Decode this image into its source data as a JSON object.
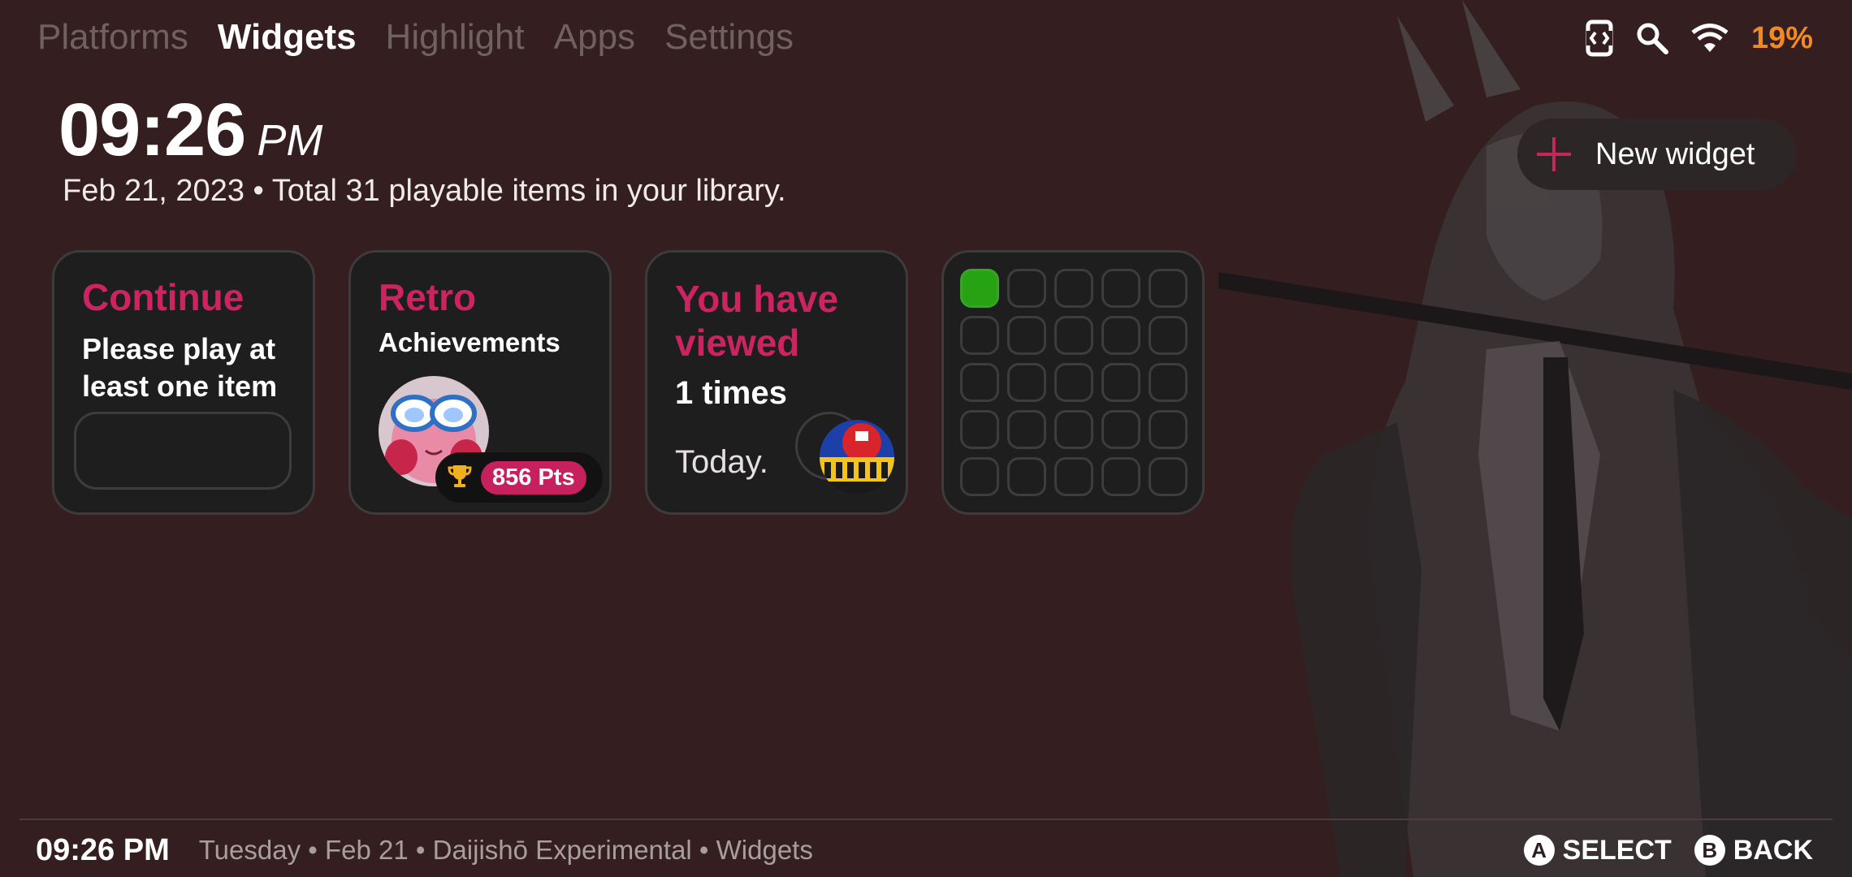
{
  "nav": {
    "tabs": [
      {
        "label": "Platforms",
        "active": false
      },
      {
        "label": "Widgets",
        "active": true
      },
      {
        "label": "Highlight",
        "active": false
      },
      {
        "label": "Apps",
        "active": false
      },
      {
        "label": "Settings",
        "active": false
      }
    ]
  },
  "status": {
    "icons": [
      "screen-rotate-icon",
      "search-icon",
      "wifi-icon"
    ],
    "battery": "19%"
  },
  "header": {
    "time": "09:26",
    "ampm": "PM",
    "subline": "Feb 21, 2023 • Total 31 playable items in your library."
  },
  "new_widget": {
    "label": "New widget"
  },
  "widgets": {
    "continue": {
      "title": "Continue",
      "line1": "Please play at",
      "line2": "least one item"
    },
    "retro": {
      "title": "Retro",
      "subtitle": "Achievements",
      "points": "856 Pts"
    },
    "viewed": {
      "title1": "You have",
      "title2": "viewed",
      "count": "1 times",
      "when": "Today."
    },
    "calendar": {
      "total_cells": 25,
      "active_cells": 1
    }
  },
  "footer": {
    "time": "09:26 PM",
    "info": "Tuesday • Feb 21 • Daijishō Experimental • Widgets",
    "hints": [
      {
        "button": "A",
        "label": "SELECT"
      },
      {
        "button": "B",
        "label": "BACK"
      }
    ]
  },
  "colors": {
    "background": "#351e1f",
    "accent": "#cc2361",
    "battery": "#f28a23",
    "active_cell": "#26a212"
  }
}
